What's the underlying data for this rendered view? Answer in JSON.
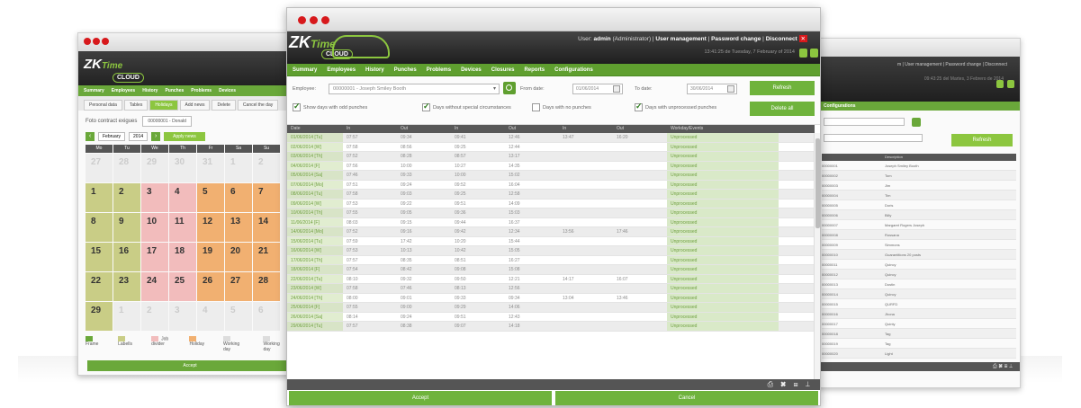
{
  "brand": {
    "zk": "ZK",
    "tag": "Time",
    "cloud": "CLOUD"
  },
  "colors": {
    "accent": "#6fb33c",
    "menu": "#5f9f2f",
    "header": "#2a2a2a",
    "close": "#d7191c"
  },
  "left_window": {
    "menu": [
      "Summary",
      "Employees",
      "History",
      "Punches",
      "Problems",
      "Devices"
    ],
    "tabs": [
      "Personal data",
      "Tables",
      "Holidays",
      "Add news",
      "Delete",
      "Cancel the day"
    ],
    "active_tab": 2,
    "filter_label": "Foto contract exigues",
    "filter_value": "00000001 - Donald",
    "month": "February",
    "year": "2014",
    "go_label": "Apply news",
    "weekdays": [
      "Mo",
      "Tu",
      "We",
      "Th",
      "Fr",
      "Sa",
      "Su"
    ],
    "days": [
      {
        "n": "27",
        "t": "ghost"
      },
      {
        "n": "28",
        "t": "ghost"
      },
      {
        "n": "29",
        "t": "ghost"
      },
      {
        "n": "30",
        "t": "ghost"
      },
      {
        "n": "31",
        "t": "ghost"
      },
      {
        "n": "1",
        "t": "ghost"
      },
      {
        "n": "2",
        "t": "ghost"
      },
      {
        "n": "1",
        "t": "ol"
      },
      {
        "n": "2",
        "t": "ol"
      },
      {
        "n": "3",
        "t": "pk"
      },
      {
        "n": "4",
        "t": "pk"
      },
      {
        "n": "5",
        "t": "or"
      },
      {
        "n": "6",
        "t": "or"
      },
      {
        "n": "7",
        "t": "or"
      },
      {
        "n": "8",
        "t": "ol"
      },
      {
        "n": "9",
        "t": "ol"
      },
      {
        "n": "10",
        "t": "pk"
      },
      {
        "n": "11",
        "t": "pk"
      },
      {
        "n": "12",
        "t": "or"
      },
      {
        "n": "13",
        "t": "or"
      },
      {
        "n": "14",
        "t": "or"
      },
      {
        "n": "15",
        "t": "ol"
      },
      {
        "n": "16",
        "t": "ol"
      },
      {
        "n": "17",
        "t": "pk"
      },
      {
        "n": "18",
        "t": "pk"
      },
      {
        "n": "19",
        "t": "or"
      },
      {
        "n": "20",
        "t": "or"
      },
      {
        "n": "21",
        "t": "or"
      },
      {
        "n": "22",
        "t": "ol"
      },
      {
        "n": "23",
        "t": "ol"
      },
      {
        "n": "24",
        "t": "pk"
      },
      {
        "n": "25",
        "t": "pk"
      },
      {
        "n": "26",
        "t": "or"
      },
      {
        "n": "27",
        "t": "or"
      },
      {
        "n": "28",
        "t": "or"
      },
      {
        "n": "29",
        "t": "ol"
      },
      {
        "n": "1",
        "t": "ghost"
      },
      {
        "n": "2",
        "t": "ghost"
      },
      {
        "n": "3",
        "t": "ghost"
      },
      {
        "n": "4",
        "t": "ghost"
      },
      {
        "n": "5",
        "t": "ghost"
      },
      {
        "n": "6",
        "t": "ghost"
      }
    ],
    "legend": [
      "Frame",
      "Labells",
      "Job divider",
      "Holiday",
      "Working day",
      "Working day"
    ],
    "accept_label": "Accept"
  },
  "right_window": {
    "header_text": "m | User management | Password change | Disconnect",
    "header_sub": "09:43:25 del Martes, 3 Febrero de 2014",
    "menu_label": "Configurations",
    "refresh_label": "Refresh",
    "column": "Description",
    "rows": [
      [
        "00000001",
        "Joseph Smiley Booth"
      ],
      [
        "00000002",
        "Tom"
      ],
      [
        "00000003",
        "Jim"
      ],
      [
        "00000004",
        "Tim"
      ],
      [
        "00000005",
        "Doris"
      ],
      [
        "00000006",
        "Billy"
      ],
      [
        "00000007",
        "Margaret Rogers Joseph"
      ],
      [
        "00000008",
        "Rossana"
      ],
      [
        "00000009",
        "Simmons"
      ],
      [
        "00000010",
        "Guarantitions 20 posts"
      ],
      [
        "00000011",
        "Quincy"
      ],
      [
        "00000012",
        "Quincy"
      ],
      [
        "00000013",
        "Dustin"
      ],
      [
        "00000014",
        "Quincy"
      ],
      [
        "00000015",
        "QURFD"
      ],
      [
        "00000016",
        "Jhona"
      ],
      [
        "00000017",
        "Quinty"
      ],
      [
        "00000018",
        "Tag"
      ],
      [
        "00000019",
        "Tag"
      ],
      [
        "00000020",
        "Light"
      ],
      [
        "00000021",
        "Ag"
      ]
    ]
  },
  "main_window": {
    "header": {
      "user_prefix": "User:",
      "user_name": "admin",
      "user_role": "(Administrator)",
      "user_mgmt": "User management",
      "password": "Password change",
      "disconnect": "Disconnect",
      "close_glyph": "✕",
      "datetime": "13:41:25 de Tuesday, 7 February of 2014"
    },
    "menu": [
      "Summary",
      "Employees",
      "History",
      "Punches",
      "Problems",
      "Devices",
      "Closures",
      "Reports",
      "Configurations"
    ],
    "filter": {
      "employee_label": "Employee:",
      "employee_value": "00000001 - Joseph Smiley Booth",
      "from_label": "From date:",
      "from_value": "01/06/2014",
      "to_label": "To date:",
      "to_value": "30/06/2014",
      "refresh_label": "Refresh",
      "delete_label": "Delete all",
      "checks": [
        {
          "label": "Show days with odd punches",
          "on": true
        },
        {
          "label": "Days without special circumstances",
          "on": true
        },
        {
          "label": "Days with no punches",
          "on": false
        },
        {
          "label": "Days with unprocessed punches",
          "on": true
        }
      ]
    },
    "columns": [
      "Date",
      "In",
      "Out",
      "In",
      "Out",
      "In",
      "Out",
      "Workday/Events"
    ],
    "rows": [
      [
        "01/06/2014 [Tu]",
        "07:57",
        "09:34",
        "09:41",
        "12:46",
        "13:47",
        "16:20",
        "Unprocessed"
      ],
      [
        "02/06/2014 [W]",
        "07:58",
        "08:56",
        "09:25",
        "12:44",
        "",
        "",
        "Unprocessed"
      ],
      [
        "03/06/2014 [Th]",
        "07:52",
        "08:28",
        "08:57",
        "13:17",
        "",
        "",
        "Unprocessed"
      ],
      [
        "04/06/2014 [F]",
        "07:56",
        "10:00",
        "10:27",
        "14:35",
        "",
        "",
        "Unprocessed"
      ],
      [
        "05/06/2014 [Sa]",
        "07:46",
        "09:33",
        "10:00",
        "15:02",
        "",
        "",
        "Unprocessed"
      ],
      [
        "07/06/2014 [Mo]",
        "07:51",
        "09:24",
        "09:52",
        "16:04",
        "",
        "",
        "Unprocessed"
      ],
      [
        "08/06/2014 [Tu]",
        "07:58",
        "09:03",
        "09:25",
        "12:58",
        "",
        "",
        "Unprocessed"
      ],
      [
        "09/06/2014 [W]",
        "07:53",
        "09:22",
        "09:51",
        "14:09",
        "",
        "",
        "Unprocessed"
      ],
      [
        "10/06/2014 [Th]",
        "07:55",
        "09:05",
        "09:36",
        "15:03",
        "",
        "",
        "Unprocessed"
      ],
      [
        "11/06/2014 [F]",
        "08:03",
        "09:15",
        "09:44",
        "16:37",
        "",
        "",
        "Unprocessed"
      ],
      [
        "14/06/2014 [Mo]",
        "07:52",
        "09:16",
        "09:42",
        "12:34",
        "13:56",
        "17:46",
        "Unprocessed"
      ],
      [
        "15/06/2014 [Tu]",
        "07:59",
        "17:42",
        "10:20",
        "15:44",
        "",
        "",
        "Unprocessed"
      ],
      [
        "16/06/2014 [W]",
        "07:53",
        "10:13",
        "10:42",
        "15:05",
        "",
        "",
        "Unprocessed"
      ],
      [
        "17/06/2014 [Th]",
        "07:57",
        "08:35",
        "08:51",
        "16:27",
        "",
        "",
        "Unprocessed"
      ],
      [
        "18/06/2014 [F]",
        "07:54",
        "08:42",
        "09:08",
        "15:08",
        "",
        "",
        "Unprocessed"
      ],
      [
        "22/06/2014 [Tu]",
        "08:10",
        "09:32",
        "09:50",
        "12:21",
        "14:17",
        "16:07",
        "Unprocessed"
      ],
      [
        "23/06/2014 [W]",
        "07:58",
        "07:46",
        "08:13",
        "12:56",
        "",
        "",
        "Unprocessed"
      ],
      [
        "24/06/2014 [Th]",
        "08:00",
        "09:01",
        "09:33",
        "09:34",
        "13:04",
        "13:46",
        "Unprocessed"
      ],
      [
        "25/06/2014 [F]",
        "07:55",
        "09:00",
        "09:29",
        "14:06",
        "",
        "",
        "Unprocessed"
      ],
      [
        "26/06/2014 [Sa]",
        "08:14",
        "09:24",
        "09:51",
        "12:43",
        "",
        "",
        "Unprocessed"
      ],
      [
        "29/06/2014 [Tu]",
        "07:57",
        "08:38",
        "09:07",
        "14:18",
        "",
        "",
        "Unprocessed"
      ]
    ],
    "toolbar_icons": [
      "printer-icon",
      "excel-icon",
      "export-icon",
      "tool-icon"
    ],
    "toolbar_glyphs": "⎙ ✖ ⊞ ⊥",
    "accept_label": "Accept",
    "cancel_label": "Cancel"
  }
}
